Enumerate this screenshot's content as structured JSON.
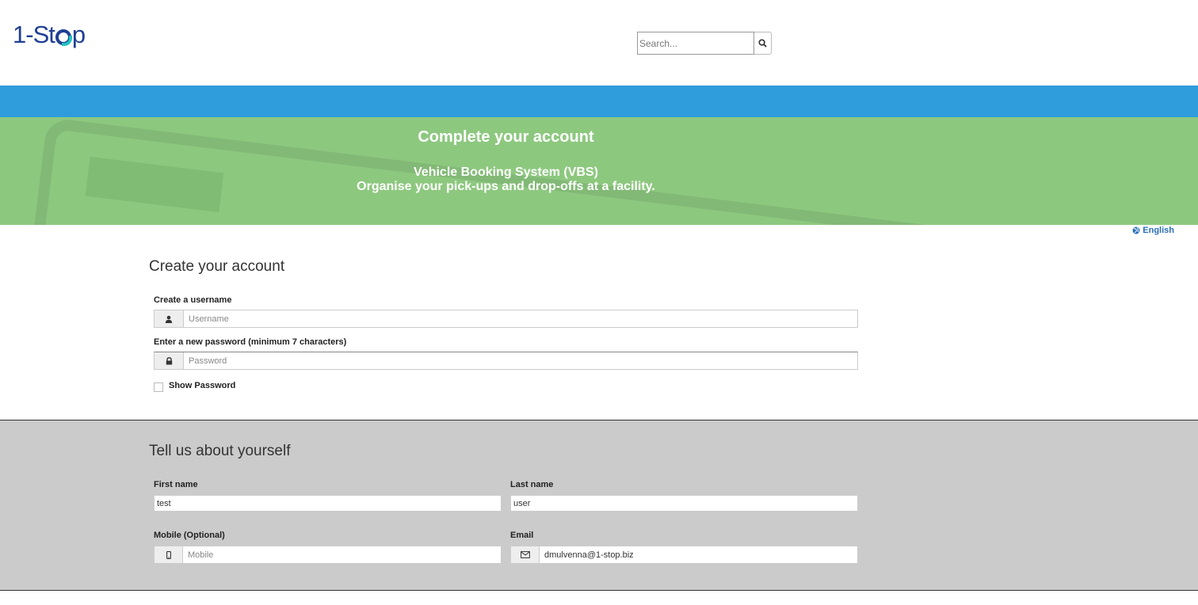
{
  "header": {
    "logo_text": "1-Stop",
    "search": {
      "placeholder": "Search...",
      "value": ""
    }
  },
  "banner": {
    "title": "Complete your account",
    "subtitle_line1": "Vehicle Booking System (VBS)",
    "subtitle_line2": "Organise your pick-ups and drop-offs at a facility."
  },
  "language": {
    "label": "English"
  },
  "account": {
    "title": "Create your account",
    "username": {
      "label": "Create a username",
      "placeholder": "Username",
      "value": "",
      "icon": "user-icon"
    },
    "password": {
      "label": "Enter a new password (minimum 7 characters)",
      "placeholder": "Password",
      "value": "",
      "icon": "lock-icon"
    },
    "show_password": {
      "label": "Show Password",
      "checked": false
    }
  },
  "about": {
    "title": "Tell us about yourself",
    "first_name": {
      "label": "First name",
      "value": "test"
    },
    "last_name": {
      "label": "Last name",
      "value": "user"
    },
    "mobile": {
      "label": "Mobile (Optional)",
      "placeholder": "Mobile",
      "value": "",
      "icon": "mobile-icon"
    },
    "email": {
      "label": "Email",
      "value": "dmulvenna@1-stop.biz",
      "icon": "envelope-icon"
    }
  },
  "colors": {
    "navbar": "#2f9ddb",
    "banner": "#8dc87f",
    "logo": "#1f3f94",
    "logo_accent": "#21c3bf",
    "link": "#2a6fb6"
  }
}
